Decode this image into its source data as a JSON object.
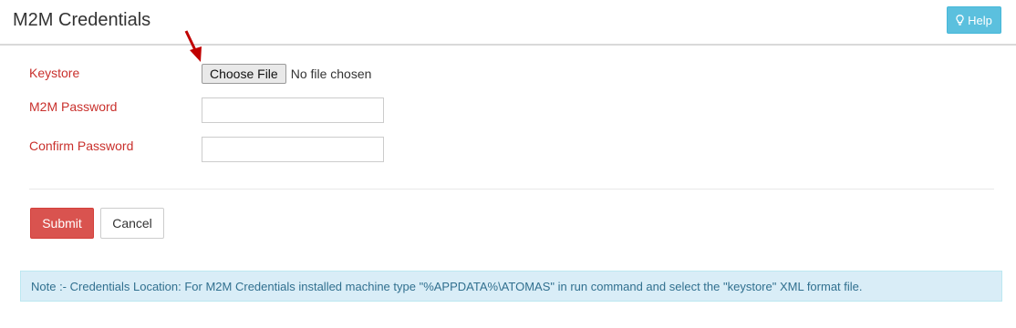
{
  "header": {
    "title": "M2M Credentials",
    "help_label": "Help",
    "help_icon": "lightbulb-icon",
    "help_color": "#5bc0de"
  },
  "form": {
    "keystore_label": "Keystore",
    "choose_file_label": "Choose File",
    "file_status": "No file chosen",
    "password_label": "M2M Password",
    "password_value": "",
    "confirm_label": "Confirm Password",
    "confirm_value": "",
    "label_color": "#c9302c"
  },
  "actions": {
    "submit_label": "Submit",
    "cancel_label": "Cancel",
    "submit_color": "#d9534f"
  },
  "note": {
    "text": "Note :- Credentials Location: For M2M Credentials installed machine type \"%APPDATA%\\ATOMAS\" in run command and select the \"keystore\" XML format file."
  },
  "annotation": {
    "icon": "red-arrow-icon",
    "color": "#c00000"
  }
}
